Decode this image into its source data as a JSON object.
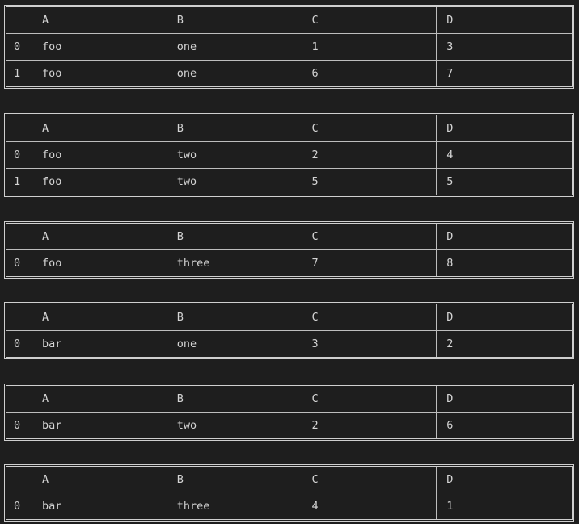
{
  "tables": [
    {
      "columns": [
        "A",
        "B",
        "C",
        "D"
      ],
      "rows": [
        {
          "index": "0",
          "cells": [
            "foo",
            "one",
            "1",
            "3"
          ]
        },
        {
          "index": "1",
          "cells": [
            "foo",
            "one",
            "6",
            "7"
          ]
        }
      ]
    },
    {
      "columns": [
        "A",
        "B",
        "C",
        "D"
      ],
      "rows": [
        {
          "index": "0",
          "cells": [
            "foo",
            "two",
            "2",
            "4"
          ]
        },
        {
          "index": "1",
          "cells": [
            "foo",
            "two",
            "5",
            "5"
          ]
        }
      ]
    },
    {
      "columns": [
        "A",
        "B",
        "C",
        "D"
      ],
      "rows": [
        {
          "index": "0",
          "cells": [
            "foo",
            "three",
            "7",
            "8"
          ]
        }
      ]
    },
    {
      "columns": [
        "A",
        "B",
        "C",
        "D"
      ],
      "rows": [
        {
          "index": "0",
          "cells": [
            "bar",
            "one",
            "3",
            "2"
          ]
        }
      ]
    },
    {
      "columns": [
        "A",
        "B",
        "C",
        "D"
      ],
      "rows": [
        {
          "index": "0",
          "cells": [
            "bar",
            "two",
            "2",
            "6"
          ]
        }
      ]
    },
    {
      "columns": [
        "A",
        "B",
        "C",
        "D"
      ],
      "rows": [
        {
          "index": "0",
          "cells": [
            "bar",
            "three",
            "4",
            "1"
          ]
        }
      ]
    }
  ],
  "colors": {
    "background": "#1e1e1e",
    "text": "#d4d4d4",
    "border": "#cfcfcf"
  }
}
